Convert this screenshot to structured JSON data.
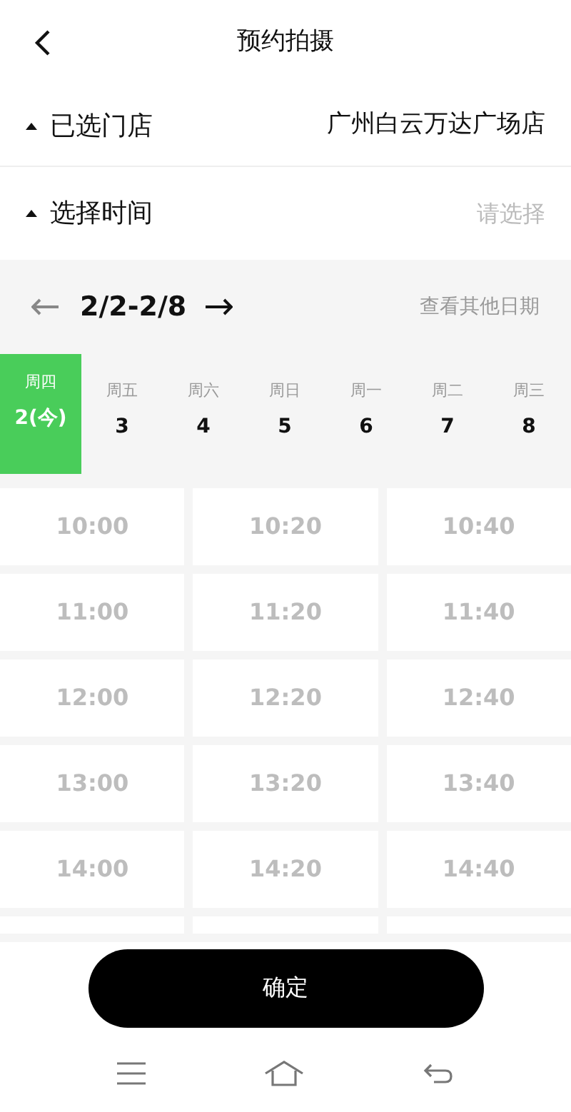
{
  "header": {
    "title": "预约拍摄"
  },
  "store": {
    "label": "已选门店",
    "value": "广州白云万达广场店",
    "expanded": true
  },
  "time": {
    "label": "选择时间",
    "placeholder": "请选择",
    "expanded": true
  },
  "week": {
    "range": "2/2-2/8",
    "other_dates": "查看其他日期"
  },
  "days": [
    {
      "weekday": "周四",
      "date": "2(今)",
      "selected": true
    },
    {
      "weekday": "周五",
      "date": "3",
      "selected": false
    },
    {
      "weekday": "周六",
      "date": "4",
      "selected": false
    },
    {
      "weekday": "周日",
      "date": "5",
      "selected": false
    },
    {
      "weekday": "周一",
      "date": "6",
      "selected": false
    },
    {
      "weekday": "周二",
      "date": "7",
      "selected": false
    },
    {
      "weekday": "周三",
      "date": "8",
      "selected": false
    }
  ],
  "slots": [
    {
      "time": "10:00",
      "disabled": true
    },
    {
      "time": "10:20",
      "disabled": true
    },
    {
      "time": "10:40",
      "disabled": true
    },
    {
      "time": "11:00",
      "disabled": true
    },
    {
      "time": "11:20",
      "disabled": true
    },
    {
      "time": "11:40",
      "disabled": true
    },
    {
      "time": "12:00",
      "disabled": true
    },
    {
      "time": "12:20",
      "disabled": true
    },
    {
      "time": "12:40",
      "disabled": true
    },
    {
      "time": "13:00",
      "disabled": true
    },
    {
      "time": "13:20",
      "disabled": true
    },
    {
      "time": "13:40",
      "disabled": true
    },
    {
      "time": "14:00",
      "disabled": true
    },
    {
      "time": "14:20",
      "disabled": true
    },
    {
      "time": "14:40",
      "disabled": true
    }
  ],
  "confirm": "确定"
}
